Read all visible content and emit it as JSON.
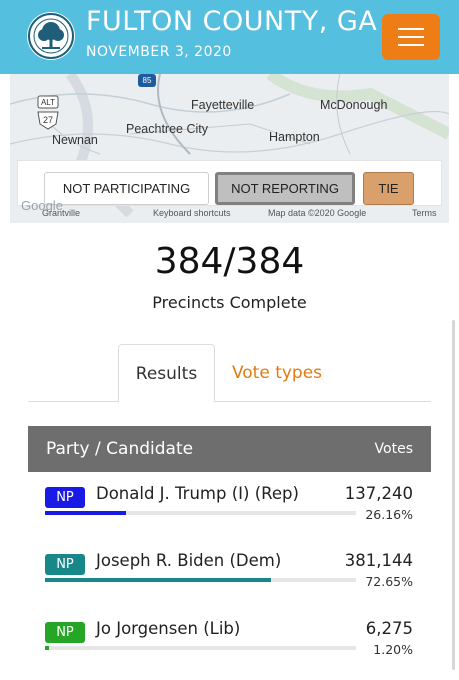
{
  "header": {
    "title": "FULTON COUNTY, GA",
    "date": "NOVEMBER 3, 2020",
    "logo_icon": "county-seal-tree-icon",
    "menu_icon": "hamburger-menu-icon",
    "background_color": "#55bfe0",
    "menu_color": "#ee7d16"
  },
  "map": {
    "cities": [
      "Fayetteville",
      "McDonough",
      "Peachtree City",
      "Newnan",
      "Hampton"
    ],
    "shields": [
      "85",
      "ALT",
      "27"
    ],
    "legend": {
      "not_participating": "NOT PARTICIPATING",
      "not_reporting": "NOT REPORTING",
      "tie": "TIE"
    },
    "footer": {
      "google": "Google",
      "partial_town": "Grantville",
      "shortcuts": "Keyboard shortcuts",
      "attribution": "Map data ©2020 Google",
      "terms": "Terms"
    }
  },
  "summary": {
    "precincts": "384/384",
    "label": "Precincts Complete"
  },
  "tabs": {
    "results": "Results",
    "vote_types": "Vote types"
  },
  "table": {
    "col_party": "Party / Candidate",
    "col_votes": "Votes",
    "rows": [
      {
        "badge": "NP",
        "badge_color": "#1a1ae6",
        "candidate": "Donald J. Trump (I) (Rep)",
        "votes": "137,240",
        "percent": "26.16%",
        "share": 0.2616,
        "bar_color": "#1a1ae6"
      },
      {
        "badge": "NP",
        "badge_color": "#17878a",
        "candidate": "Joseph R. Biden (Dem)",
        "votes": "381,144",
        "percent": "72.65%",
        "share": 0.7265,
        "bar_color": "#17878a"
      },
      {
        "badge": "NP",
        "badge_color": "#26a626",
        "candidate": "Jo Jorgensen (Lib)",
        "votes": "6,275",
        "percent": "1.20%",
        "share": 0.012,
        "bar_color": "#26a626"
      }
    ]
  }
}
